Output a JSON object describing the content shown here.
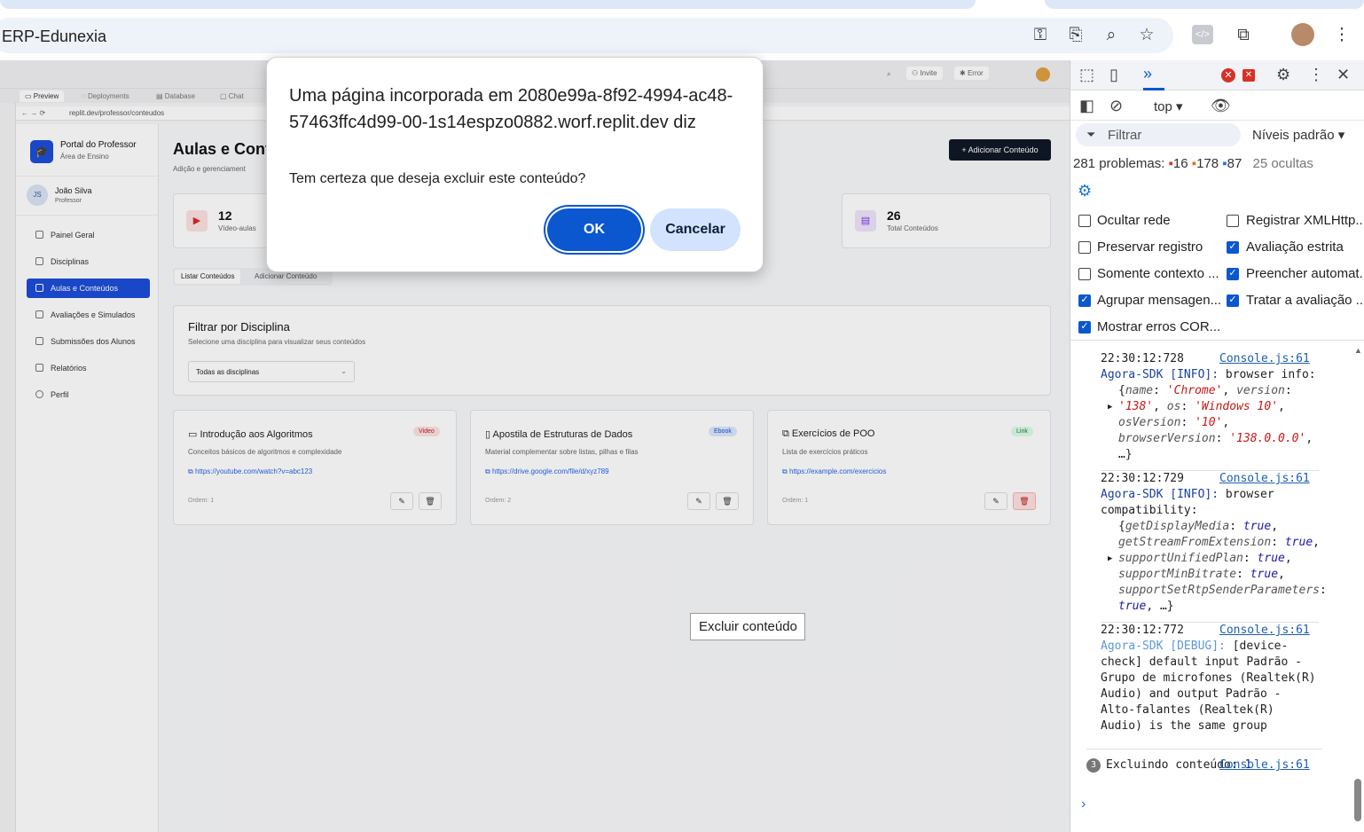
{
  "browser": {
    "address_text": "ERP-Edunexia"
  },
  "replit": {
    "topbar": {
      "invite": "Invite",
      "error": "Error"
    },
    "tabs": [
      "Preview",
      "Deployments",
      "Database",
      "Chat"
    ],
    "url": "replit.dev/professor/conteudos"
  },
  "sidebar": {
    "brand_title": "Portal do Professor",
    "brand_sub": "Área de Ensino",
    "user_initials": "JS",
    "user_name": "João Silva",
    "user_role": "Professor",
    "items": [
      {
        "label": "Painel Geral"
      },
      {
        "label": "Disciplinas"
      },
      {
        "label": "Aulas e Conteúdos"
      },
      {
        "label": "Avaliações e Simulados"
      },
      {
        "label": "Submissões dos Alunos"
      },
      {
        "label": "Relatórios"
      },
      {
        "label": "Perfil"
      }
    ]
  },
  "main": {
    "title": "Aulas e Cont",
    "subtitle": "Adição e gerenciament",
    "add_button": "Adicionar Conteúdo",
    "stats": [
      {
        "value": "12",
        "label": "Vídeo-aulas"
      },
      {
        "value": "26",
        "label": "Total Conteúdos"
      }
    ],
    "tabs": [
      "Listar Conteúdos",
      "Adicionar Conteúdo"
    ],
    "filter_title": "Filtrar por Disciplina",
    "filter_sub": "Selecione uma disciplina para visualizar seus conteúdos",
    "filter_value": "Todas as disciplinas",
    "cards": [
      {
        "title": "Introdução aos Algoritmos",
        "badge": "Video",
        "desc": "Conceitos básicos de algoritmos e complexidade",
        "link": "https://youtube.com/watch?v=abc123",
        "order": "Ordem: 1"
      },
      {
        "title": "Apostila de Estruturas de Dados",
        "badge": "Ebook",
        "desc": "Material complementar sobre listas, pilhas e filas",
        "link": "https://drive.google.com/file/d/xyz789",
        "order": "Ordem: 2"
      },
      {
        "title": "Exercícios de POO",
        "badge": "Link",
        "desc": "Lista de exercícios práticos",
        "link": "https://example.com/exercicios",
        "order": "Ordem: 1"
      }
    ]
  },
  "dialog": {
    "title": "Uma página incorporada em 2080e99a-8f92-4994-ac48-57463ffc4d99-00-1s14espzo0882.worf.replit.dev diz",
    "message": "Tem certeza que deseja excluir este conteúdo?",
    "ok": "OK",
    "cancel": "Cancelar"
  },
  "tooltip": "Excluir conteúdo",
  "devtools": {
    "context": "top",
    "filter_placeholder": "Filtrar",
    "levels": "Níveis padrão",
    "problems_label": "281 problemas:",
    "errors": "16",
    "warnings": "178",
    "infos": "87",
    "hidden": "25 ocultas",
    "options": [
      {
        "label": "Ocultar rede",
        "checked": false
      },
      {
        "label": "Registrar XMLHttp...",
        "checked": false
      },
      {
        "label": "Preservar registro",
        "checked": false
      },
      {
        "label": "Avaliação estrita",
        "checked": true
      },
      {
        "label": "Somente contexto ...",
        "checked": false
      },
      {
        "label": "Preencher automat...",
        "checked": true
      },
      {
        "label": "Agrupar mensagen...",
        "checked": true
      },
      {
        "label": "Tratar a avaliação ...",
        "checked": true
      },
      {
        "label": "Mostrar erros COR...",
        "checked": true
      }
    ],
    "logs": [
      {
        "time": "22:30:12:728",
        "src": "Console.js:61",
        "tag": "Agora-SDK [INFO]:",
        "text": "browser info:"
      },
      {
        "time": "22:30:12:729",
        "src": "Console.js:61",
        "tag": "Agora-SDK [INFO]:",
        "text": "browser compatibility:"
      },
      {
        "time": "22:30:12:772",
        "src": "Console.js:61",
        "tag": "Agora-SDK [DEBUG]:",
        "text": "[device-check] default input Padrão - Grupo de microfones (Realtek(R) Audio) and output Padrão - Alto-falantes (Realtek(R) Audio) is the same group"
      },
      {
        "count": "3",
        "src": "Console.js:61",
        "text": "Excluindo conteúdo:",
        "value": "1"
      }
    ]
  }
}
